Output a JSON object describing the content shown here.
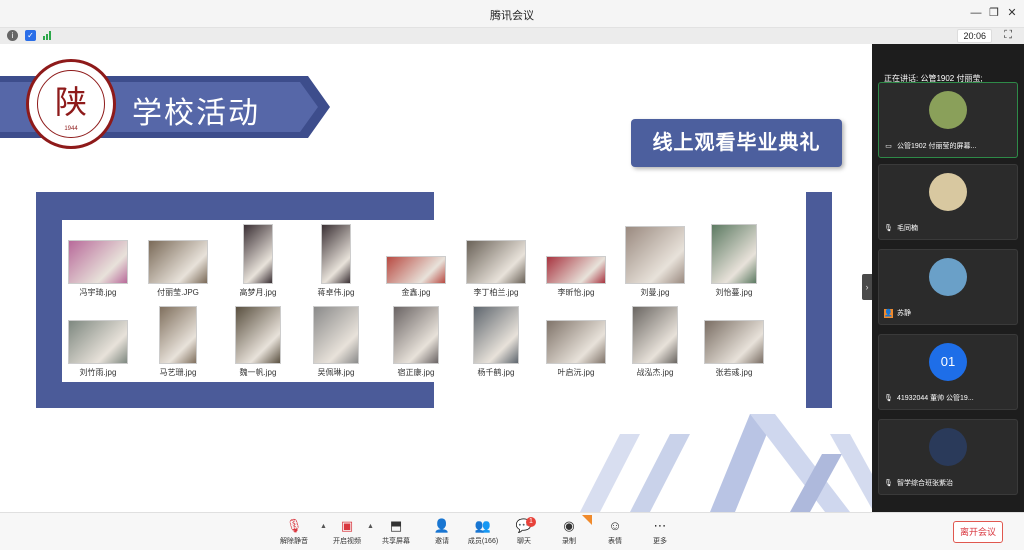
{
  "window": {
    "title": "腾讯会议",
    "clock": "20:06"
  },
  "slide": {
    "heading": "学校活动",
    "logo_char": "陕",
    "logo_year": "1944",
    "subheading": "线上观看毕业典礼",
    "photos_row1": [
      {
        "name": "冯宇琦.jpg",
        "color": "#b86a9a"
      },
      {
        "name": "付丽莹.JPG",
        "color": "#7a6a58"
      },
      {
        "name": "高梦月.jpg",
        "color": "#3a2f34"
      },
      {
        "name": "蒋卓伟.jpg",
        "color": "#3a3034"
      },
      {
        "name": "金鑫.jpg",
        "color": "#b84a42"
      },
      {
        "name": "李丁柏兰.jpg",
        "color": "#6a6258"
      },
      {
        "name": "李昕怡.jpg",
        "color": "#a83440"
      },
      {
        "name": "刘曼.jpg",
        "color": "#9a8a80"
      },
      {
        "name": "刘怡蔓.jpg",
        "color": "#5c7a62"
      }
    ],
    "photos_row2": [
      {
        "name": "刘竹雨.jpg",
        "color": "#7e8880"
      },
      {
        "name": "马艺珊.jpg",
        "color": "#80705e"
      },
      {
        "name": "魏一帆.jpg",
        "color": "#5a5040"
      },
      {
        "name": "吴佩琳.jpg",
        "color": "#8a8a8a"
      },
      {
        "name": "宿正康.jpg",
        "color": "#6a6464"
      },
      {
        "name": "杨千鹤.jpg",
        "color": "#5e666e"
      },
      {
        "name": "叶启沅.jpg",
        "color": "#80746a"
      },
      {
        "name": "战泓杰.jpg",
        "color": "#6a6662"
      },
      {
        "name": "张若彧.jpg",
        "color": "#7a6e64"
      }
    ]
  },
  "sidebar": {
    "speaking": "正在讲话: 公管1902 付丽莹;",
    "participants": [
      {
        "name": "公管1902 付丽莹的屏幕...",
        "avatar_color": "#8aa05a",
        "avatar_text": "",
        "icon": "screen-share-icon"
      },
      {
        "name": "毛同楠",
        "avatar_color": "#d8c8a0",
        "avatar_text": "",
        "icon": "mic-muted-icon"
      },
      {
        "name": "苏静",
        "avatar_color": "#6aa0c8",
        "avatar_text": "",
        "icon": "user-badge-icon"
      },
      {
        "name": "41932044 董帅 公管19...",
        "avatar_color": "#1e6ee8",
        "avatar_text": "01",
        "icon": "mic-muted-icon"
      },
      {
        "name": "智学综合班张紫治",
        "avatar_color": "#2a3a5a",
        "avatar_text": "",
        "icon": "mic-muted-icon"
      }
    ]
  },
  "toolbar": {
    "unmute": "解除静音",
    "video": "开启视频",
    "share": "共享屏幕",
    "invite": "邀请",
    "members": "成员(166)",
    "chat": "聊天",
    "chat_badge": "1",
    "record": "录制",
    "emoji": "表情",
    "more": "更多",
    "leave": "离开会议"
  }
}
